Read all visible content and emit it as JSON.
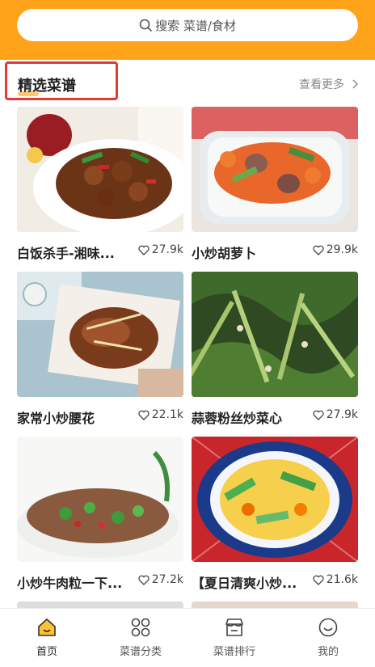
{
  "search": {
    "placeholder": "搜索 菜谱/食材"
  },
  "section": {
    "title": "精选菜谱",
    "more_label": "查看更多"
  },
  "recipes": [
    {
      "title": "白饭杀手-湘味...",
      "likes": "27.9k"
    },
    {
      "title": "小炒胡萝卜",
      "likes": "29.9k"
    },
    {
      "title": "家常小炒腰花",
      "likes": "22.1k"
    },
    {
      "title": "蒜蓉粉丝炒菜心",
      "likes": "27.9k"
    },
    {
      "title": "小炒牛肉粒一下...",
      "likes": "27.2k"
    },
    {
      "title": "【夏日清爽小炒...",
      "likes": "21.6k"
    }
  ],
  "tabs": [
    {
      "label": "首页",
      "icon": "home-icon"
    },
    {
      "label": "菜谱分类",
      "icon": "category-icon"
    },
    {
      "label": "菜谱排行",
      "icon": "ranking-icon"
    },
    {
      "label": "我的",
      "icon": "profile-icon"
    }
  ],
  "colors": {
    "accent": "#ffa31a",
    "highlight_box": "#e53935"
  }
}
